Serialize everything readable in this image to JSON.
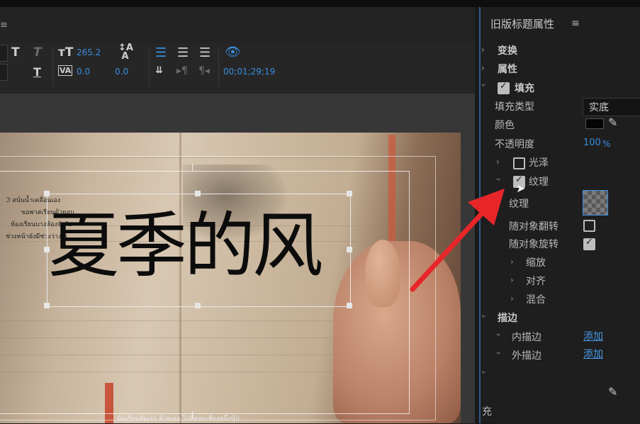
{
  "toolbar": {
    "font_size": "265.2",
    "kerning": "0.0",
    "leading": "0.0",
    "timecode": "00;01;29;19"
  },
  "canvas": {
    "title_text": "夏季的风",
    "bg_text_lines": [
      "ℑ สนั่นน้ำเคลื่อนเอง",
      "ขอพาสเรียนด้วยอบ",
      "ห้องเรียนบางห้องจังลัย",
      "ช่วงหน้ายังมีช่วงว่างเย"
    ],
    "subtitle_fragment": "นั่นเรียนส้มเรอ ด้วยเธอ ไม่มีตลบเพียงหนึ่งบุ้ป"
  },
  "panel": {
    "title": "旧版标题属性",
    "menu_icon": "≡",
    "sections": {
      "transform": "变换",
      "properties": "属性",
      "fill": "填充",
      "stroke": "描边"
    },
    "fill": {
      "fill_type_label": "填充类型",
      "fill_type_value": "实底",
      "color_label": "颜色",
      "color_value": "#050505",
      "opacity_label": "不透明度",
      "opacity_value": "100",
      "opacity_unit": "%",
      "sheen_label": "光泽",
      "texture_section_label": "纹理",
      "texture_label": "纹理",
      "flip_with_object_label": "随对象翻转",
      "rotate_with_object_label": "随对象旋转",
      "scale_label": "缩放",
      "align_label": "对齐",
      "blend_label": "混合"
    },
    "stroke": {
      "inner_label": "内描边",
      "inner_action": "添加",
      "outer_label": "外描边",
      "outer_action": "添加"
    },
    "bottom_char": "充"
  },
  "colors": {
    "accent": "#3a8fe0",
    "arrow": "#e8262a"
  }
}
